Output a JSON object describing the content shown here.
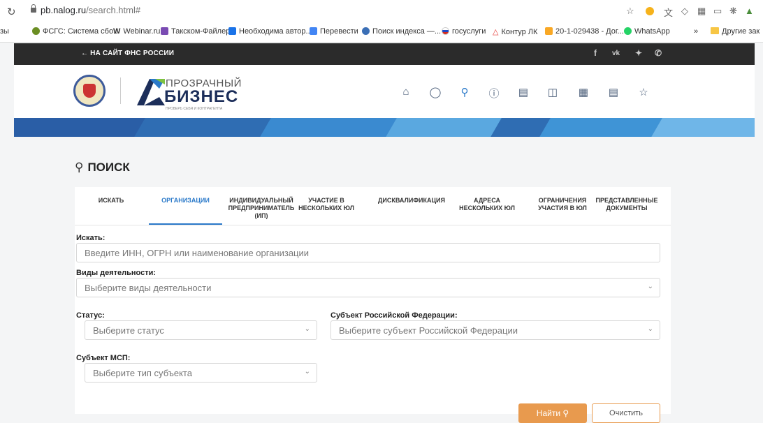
{
  "browser": {
    "url_host": "pb.nalog.ru",
    "url_path": "/search.html#"
  },
  "bookmarks": {
    "items": [
      {
        "label": "зы",
        "color": "#ffffff"
      },
      {
        "label": "ФСГС: Система сбо...",
        "color": "#6b8e23"
      },
      {
        "label": "Webinar.ru",
        "color": "#222222"
      },
      {
        "label": "Такском-Файлер",
        "color": "#7a4bb3"
      },
      {
        "label": "Необходима автор...",
        "color": "#1a73e8"
      },
      {
        "label": "Перевести",
        "color": "#4285f4"
      },
      {
        "label": "Поиск индекса —...",
        "color": "#3b6fb6"
      },
      {
        "label": "госуслуги",
        "color": "#d52b1e"
      },
      {
        "label": "Контур ЛК",
        "color": "#e53935"
      },
      {
        "label": "20-1-029438 - Дог...",
        "color": "#f9a825"
      },
      {
        "label": "WhatsApp",
        "color": "#25d366"
      }
    ],
    "more": "»",
    "other": "Другие зак"
  },
  "topbar": {
    "back_link": "← НА САЙТ ФНС РОССИИ",
    "social": [
      "f",
      "vk",
      "twitter",
      "phone"
    ]
  },
  "header": {
    "brand_line1": "ПРОЗРАЧНЫЙ",
    "brand_line2": "БИЗНЕС",
    "brand_line3": "ПРОВЕРЬ СЕБЯ И КОНТРАГЕНТА",
    "nav_icons": [
      "home-icon",
      "lightbulb-icon",
      "search-icon",
      "help-icon",
      "chat-icon",
      "database-icon",
      "calculator-icon",
      "list-icon",
      "star-icon"
    ]
  },
  "search": {
    "title": "ПОИСК",
    "tabs": [
      {
        "label": "ИСКАТЬ",
        "active": false
      },
      {
        "label": "ОРГАНИЗАЦИИ",
        "active": true
      },
      {
        "label": "ИНДИВИДУАЛЬНЫЙ ПРЕДПРИНИМАТЕЛЬ (ИП)",
        "active": false
      },
      {
        "label": "УЧАСТИЕ В НЕСКОЛЬКИХ ЮЛ",
        "active": false
      },
      {
        "label": "ДИСКВАЛИФИКАЦИЯ",
        "active": false
      },
      {
        "label": "АДРЕСА НЕСКОЛЬКИХ ЮЛ",
        "active": false
      },
      {
        "label": "ОГРАНИЧЕНИЯ УЧАСТИЯ В ЮЛ",
        "active": false
      },
      {
        "label": "ПРЕДСТАВЛЕННЫЕ ДОКУМЕНТЫ",
        "active": false
      }
    ],
    "query_label": "Искать:",
    "query_placeholder": "Введите ИНН, ОГРН или наименование организации",
    "activity_label": "Виды деятельности:",
    "activity_placeholder": "Выберите виды деятельности",
    "status_label": "Статус:",
    "status_placeholder": "Выберите статус",
    "region_label": "Субъект Российской Федерации:",
    "region_placeholder": "Выберите субъект Российской Федерации",
    "msp_label": "Субъект МСП:",
    "msp_placeholder": "Выберите тип субъекта",
    "find_button": "Найти",
    "clear_button": "Очистить"
  }
}
